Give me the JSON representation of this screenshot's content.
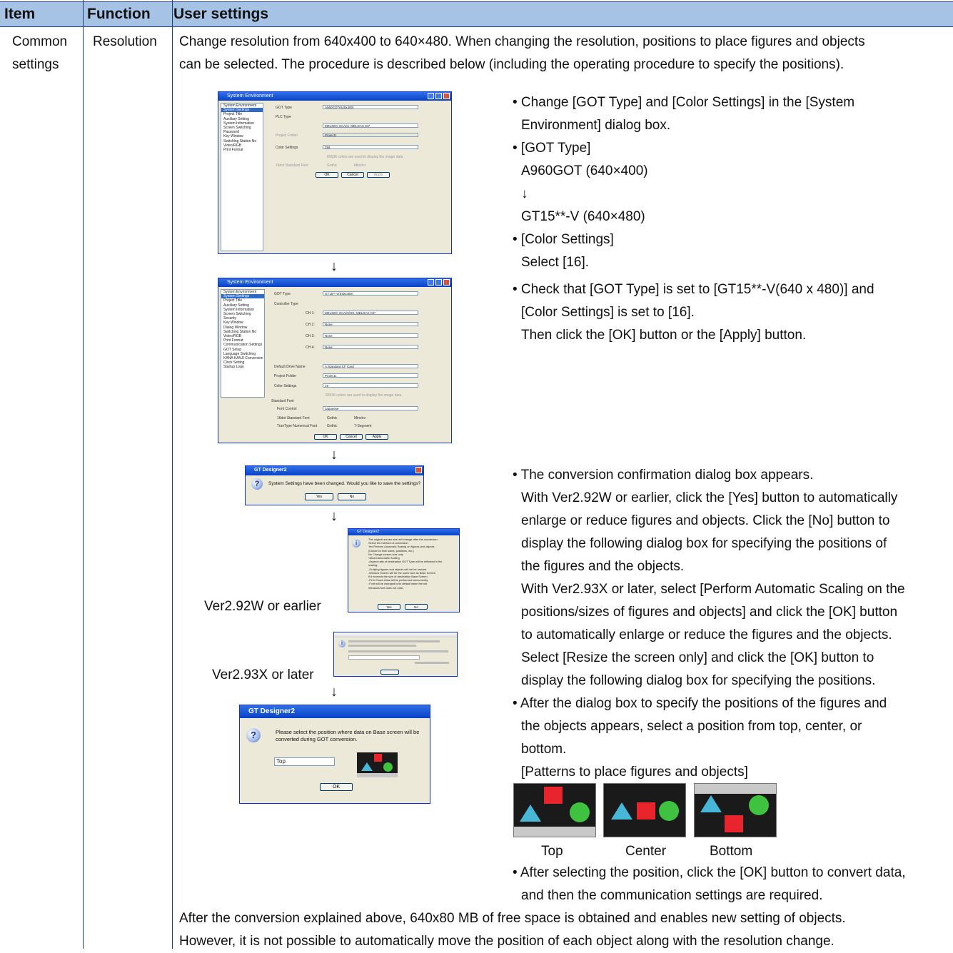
{
  "header": {
    "item": "Item",
    "function": "Function",
    "user_settings": "User settings"
  },
  "row": {
    "item": [
      "Common",
      "settings"
    ],
    "function": "Resolution",
    "intro": [
      "Change resolution from 640x400 to 640×480. When changing the resolution, positions to place figures and objects",
      "can be selected. The procedure is described below (including the operating procedure to specify the positions)."
    ]
  },
  "screen1": {
    "title": "System Environment",
    "tree": [
      "System Environment",
      "System Settings",
      "Project Title",
      "Auxiliary Setting",
      "System Information",
      "Screen Switching",
      "Password",
      "Key Window",
      "Switching Station No",
      "Video/RGB",
      "Print Format"
    ],
    "fields": {
      "got_type_label": "GOT Type",
      "got_type": "A960GOT(640x400)",
      "plc_type_label": "PLC Type",
      "plc_type": "MELSEC-QnA/Q, MELDAS C6*",
      "project_folder_label": "Project Folder",
      "project_folder": "Project1",
      "color_label": "Color Settings",
      "color": "256",
      "check": "65536 colors are used to display the image data",
      "font_label": "16dot Standard Font",
      "gothic": "Gothic",
      "mincho": "Mincho"
    },
    "buttons": [
      "OK",
      "Cancel",
      "Apply"
    ]
  },
  "screen2": {
    "title": "System Environment",
    "tree": [
      "System Environment",
      "System Settings",
      "Project Title",
      "Auxiliary Setting",
      "System Information",
      "Screen Switching",
      "Security",
      "Key Window",
      "Dialog Window",
      "Switching Station No",
      "Video/RGB",
      "Print Format",
      "Communication Settings",
      "GOT Setup",
      "Language Switching",
      "KANA KANJI Conversion",
      "Clock Setting",
      "Startup Logo"
    ],
    "fields": {
      "got_type_label": "GOT Type",
      "got_type": "GT15**-V(640x480)",
      "controller_label": "Controller Type",
      "ch1": "CH 1:",
      "ch1_val": "MELSEC-QnA/Q/QS, MELDAS C6*",
      "ch2": "CH 2:",
      "ch3": "CH 3:",
      "ch4": "CH 4:",
      "none": "None",
      "drive_label": "Default Drive Name",
      "drive": "A:Standard CF Card",
      "project_folder_label": "Project Folder",
      "project_folder": "Project1",
      "color_label": "Color Settings",
      "color": "16",
      "check": "65536 colors are used to display the image data",
      "std_font": "Standard Font",
      "font_control_label": "Font Control",
      "font_control": "Japanese",
      "font16_label": "16dot Standard Font",
      "truetype_label": "TrueType Numerical Font",
      "gothic": "Gothic",
      "mincho": "Mincho",
      "seg": "7-Segment"
    },
    "buttons": [
      "OK",
      "Cancel",
      "Apply"
    ]
  },
  "dialog_confirm": {
    "title": "GT Designer2",
    "message": "System Settings have been changed. Would you like to save the settings?",
    "yes": "Yes",
    "no": "No"
  },
  "dialog_old": {
    "title": "GT Designer2",
    "lines": [
      "The original screen size will change after the conversion.",
      "Select the method of conversion.",
      "Yes   Perform Automatic Scaling on figures and objects.",
      "        (Check for their sizes, positions, etc.)",
      "No    Change screen size only.",
      "*About Automatic Scaling",
      "-Aspect ratio of destination GOT Type will be reflected in the",
      "  scaling.",
      "-Outlying figures and objects will not be resized.",
      "-Window Screen will be the same size as Base Screen",
      "  if it exceeds the size of destination Base Screen.",
      "-Fit in Touch Area will be performed concurrently.",
      "-Font will be changed to its default when the set",
      "  Windows font does not exist."
    ],
    "yes": "Yes",
    "no": "No"
  },
  "label_old": "Ver2.92W or earlier",
  "label_new": "Ver2.93X or later",
  "dialog_pos": {
    "title": "GT Designer2",
    "message": [
      "Please select the position where data on Base screen will be",
      "converted during GOT conversion."
    ],
    "select": "Top",
    "ok": "OK"
  },
  "right": {
    "b1": [
      "• Change [GOT Type] and [Color Settings] in the [System",
      "Environment] dialog box."
    ],
    "b2": "•   [GOT Type]",
    "b2a": "A960GOT (640×400)",
    "b2arrow": "↓",
    "b2b": "GT15**-V (640×480)",
    "b3": "• [Color Settings]",
    "b3a": "Select [16].",
    "b4": [
      "• Check that [GOT Type] is set to [GT15**-V(640 x 480)] and",
      "[Color Settings] is set to [16].",
      "Then click the [OK] button or the [Apply] button."
    ],
    "b5": [
      "• The conversion confirmation dialog box appears.",
      "With Ver2.92W or earlier, click the [Yes] button to automatically",
      "enlarge or reduce figures and objects. Click the [No] button to",
      "display the following dialog box for specifying the positions of",
      "the figures and the objects.",
      "With Ver2.93X or later, select [Perform Automatic Scaling on the",
      "positions/sizes of figures and objects] and click the [OK] button",
      "to automatically enlarge or reduce the figures and the objects.",
      "Select [Resize the screen only] and click the [OK] button to",
      "display the following dialog box for specifying the positions."
    ],
    "b6": [
      "• After the dialog box to specify the positions of the figures and",
      "the objects appears, select a position from top, center, or",
      "bottom."
    ],
    "patterns_title": "[Patterns to place figures and objects]",
    "pattern_labels": [
      "Top",
      "Center",
      "Bottom"
    ],
    "b7": [
      "• After selecting the position, click the [OK] button to convert data,",
      "and then the communication settings are required."
    ]
  },
  "footer": [
    "After the conversion explained above, 640x80 MB of free space is obtained and enables new setting of objects.",
    "However, it is not possible to automatically move the position of each object along with the resolution change."
  ],
  "arrow": "↓",
  "colors": {
    "header_bg": "#a6c3e5",
    "rule": "#1f3f7a",
    "tri": "#48b6d6",
    "square": "#e8242c",
    "circle": "#3fc23f"
  }
}
